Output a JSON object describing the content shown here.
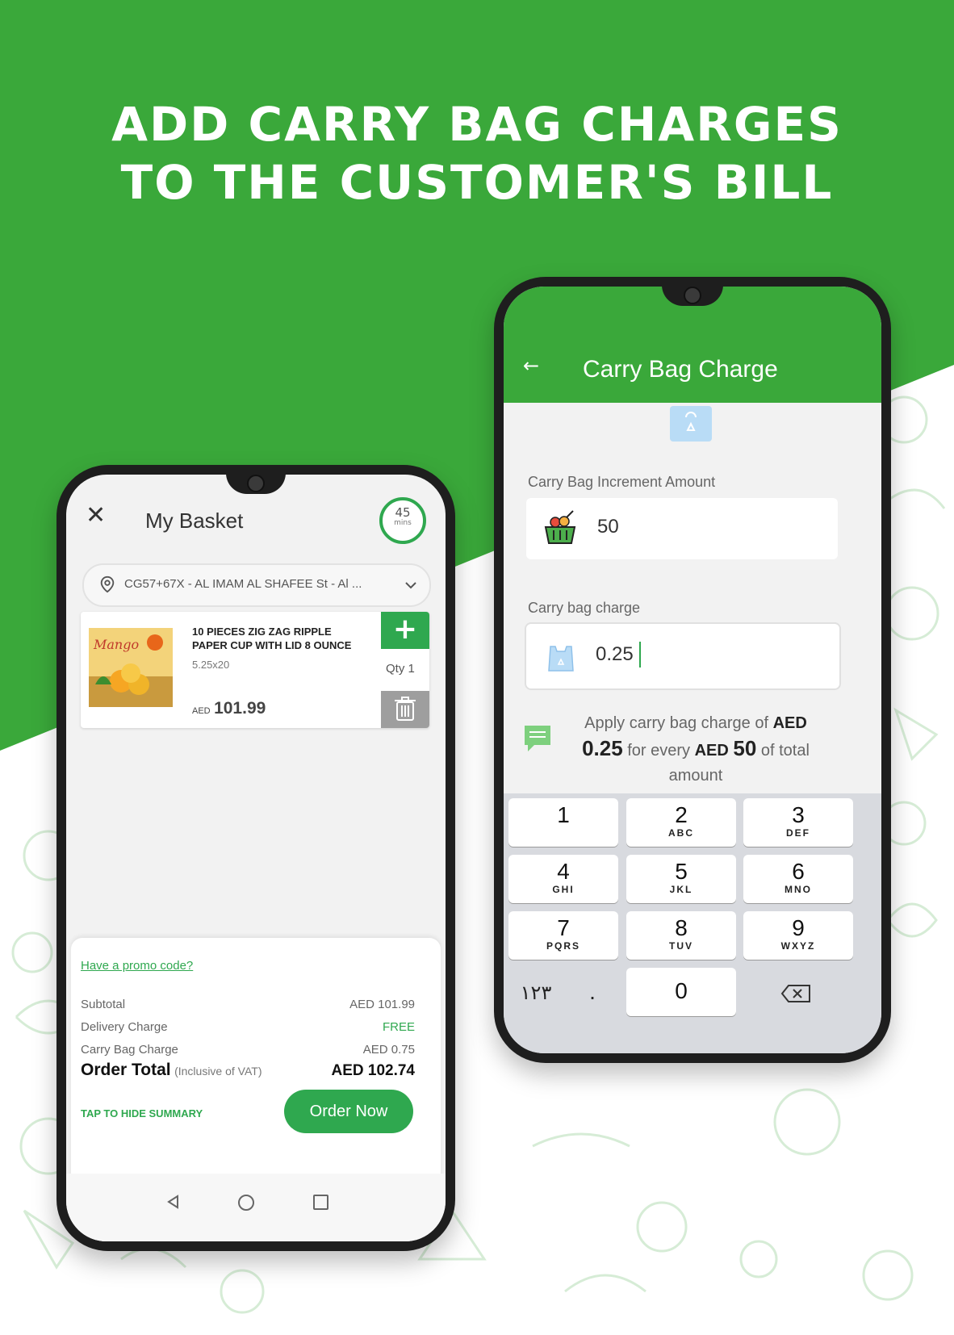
{
  "headline": {
    "line1": "ADD CARRY BAG CHARGES",
    "line2": "TO THE CUSTOMER'S BILL"
  },
  "colors": {
    "brand_green": "#3aa83a",
    "button_green": "#2fa84f",
    "white": "#ffffff"
  },
  "basket": {
    "close_icon": "close-icon",
    "title": "My Basket",
    "timer_value": "45",
    "timer_unit": "mins",
    "address": "CG57+67X - AL IMAM AL SHAFEE St - Al ...",
    "item": {
      "name": "10 PIECES ZIG ZAG RIPPLE PAPER CUP WITH LID 8 OUNCE",
      "size": "5.25x20",
      "currency": "AED",
      "price": "101.99",
      "qty_label": "Qty 1",
      "add_label": "+",
      "image_text": "Mango"
    },
    "summary": {
      "promo": "Have a promo code?",
      "subtotal_label": "Subtotal",
      "subtotal_value": "AED 101.99",
      "delivery_label": "Delivery Charge",
      "delivery_value": "FREE",
      "carrybag_label": "Carry Bag Charge",
      "carrybag_value": "AED 0.75",
      "total_label": "Order Total",
      "total_sub": "(Inclusive of VAT)",
      "total_value": "AED 102.74",
      "tap_hide": "TAP TO HIDE SUMMARY",
      "order_button": "Order Now"
    }
  },
  "carry_bag": {
    "back_icon": "back-arrow-icon",
    "title": "Carry Bag Charge",
    "increment_label": "Carry Bag Increment Amount",
    "increment_value": "50",
    "charge_label": "Carry bag charge",
    "charge_value": "0.25",
    "info": {
      "p1": "Apply carry bag charge of",
      "c1": "AED",
      "v1": "0.25",
      "p2": "for every",
      "c2": "AED",
      "v2": "50",
      "p3": "of total amount"
    },
    "keypad": {
      "keys": [
        {
          "d": "1",
          "l": ""
        },
        {
          "d": "2",
          "l": "ABC"
        },
        {
          "d": "3",
          "l": "DEF"
        },
        {
          "d": "4",
          "l": "GHI"
        },
        {
          "d": "5",
          "l": "JKL"
        },
        {
          "d": "6",
          "l": "MNO"
        },
        {
          "d": "7",
          "l": "PQRS"
        },
        {
          "d": "8",
          "l": "TUV"
        },
        {
          "d": "9",
          "l": "WXYZ"
        }
      ],
      "arabic_label": "١٢٣",
      "dot_label": ".",
      "zero_label": "0",
      "backspace_icon": "backspace-icon"
    }
  }
}
